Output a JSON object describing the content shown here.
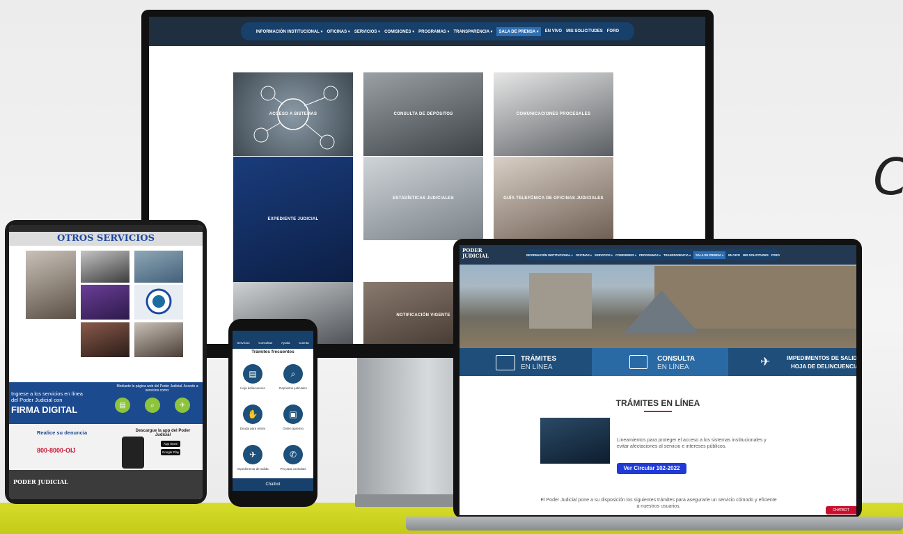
{
  "colors": {
    "accent": "#17406b",
    "floor": "#d6dc2a",
    "button": "#1f3ad6",
    "icon_circle": "#1c4f7a"
  },
  "side_letter": "C",
  "monitor": {
    "nav": [
      "INFORMACIÓN INSTITUCIONAL ▾",
      "OFICINAS ▾",
      "SERVICIOS ▾",
      "COMISIONES ▾",
      "PROGRAMAS ▾",
      "TRANSPARENCIA ▾",
      "SALA DE PRENSA ▾",
      "EN VIVO",
      "MIS SOLICITUDES",
      "FORO"
    ],
    "active_nav": "SALA DE PRENSA ▾",
    "tiles": [
      "ACCESO A SISTEMAS",
      "CONSULTA DE DEPÓSITOS",
      "COMUNICACIONES PROCESALES",
      "EXPEDIENTE JUDICIAL",
      "ESTADÍSTICAS JUDICIALES",
      "GUÍA TELEFÓNICA DE OFICINAS JUDICIALES",
      "",
      "NOTIFICACIÓN VIGENTE"
    ]
  },
  "tablet": {
    "title": "OTROS SERVICIOS",
    "banner_left": "Ingrese a los servicios en línea del Poder Judicial con",
    "banner_strong": "FIRMA DIGITAL",
    "banner_right": "Mediante la página web del Poder Judicial. Accede a servicios como:",
    "denuncia": "Realice su denuncia",
    "phone_number": "800-8000-OIJ",
    "app_title": "Descargue la app del Poder Judicial",
    "store1": "App Store",
    "store2": "Google Play",
    "logo": "PODER JUDICIAL"
  },
  "phone": {
    "tabs": [
      "Servicios",
      "Consultas",
      "Ayuda",
      "Cuenta"
    ],
    "section": "Trámites frecuentes",
    "items": [
      {
        "label": "Hoja delincuencia",
        "icon": "id-card-icon",
        "glyph": "▤"
      },
      {
        "label": "Depósitos judiciales",
        "icon": "search-icon",
        "glyph": "⌕"
      },
      {
        "label": "Deuda para retirar",
        "icon": "hand-icon",
        "glyph": "✋"
      },
      {
        "label": "Orden apremio",
        "icon": "document-icon",
        "glyph": "▣"
      },
      {
        "label": "Impedimento de salida",
        "icon": "plane-icon",
        "glyph": "✈"
      },
      {
        "label": "Pin para consultas",
        "icon": "phone-icon",
        "glyph": "✆"
      }
    ],
    "chatbot": "Chatbot"
  },
  "laptop": {
    "logo": "PODER JUDICIAL",
    "nav": [
      "INFORMACIÓN INSTITUCIONAL ▾",
      "OFICINAS ▾",
      "SERVICIOS ▾",
      "COMISIONES ▾",
      "PROGRAMAS ▾",
      "TRANSPARENCIA ▾",
      "SALA DE PRENSA ▾",
      "EN VIVO",
      "MIS SOLICITUDES",
      "FORO"
    ],
    "tab1_a": "TRÁMITES",
    "tab1_b": "EN LÍNEA",
    "tab2_a": "CONSULTA",
    "tab2_b": "EN LÍNEA",
    "tab3_a": "IMPEDIMENTOS DE SALIDA",
    "tab3_b": "HOJA DE DELINCUENCIA",
    "heading": "TRÁMITES EN LÍNEA",
    "paragraph": "Lineamientos para proteger el acceso a los sistemas institucionales y evitar afectaciones al servicio e intereses públicos.",
    "button": "Ver Circular 102-2022",
    "footer": "El Poder Judicial pone a su disposición los siguientes trámites para asegurarle un servicio cómodo y eficiente a nuestros usuarios.",
    "chatbot": "CHATBOT"
  }
}
